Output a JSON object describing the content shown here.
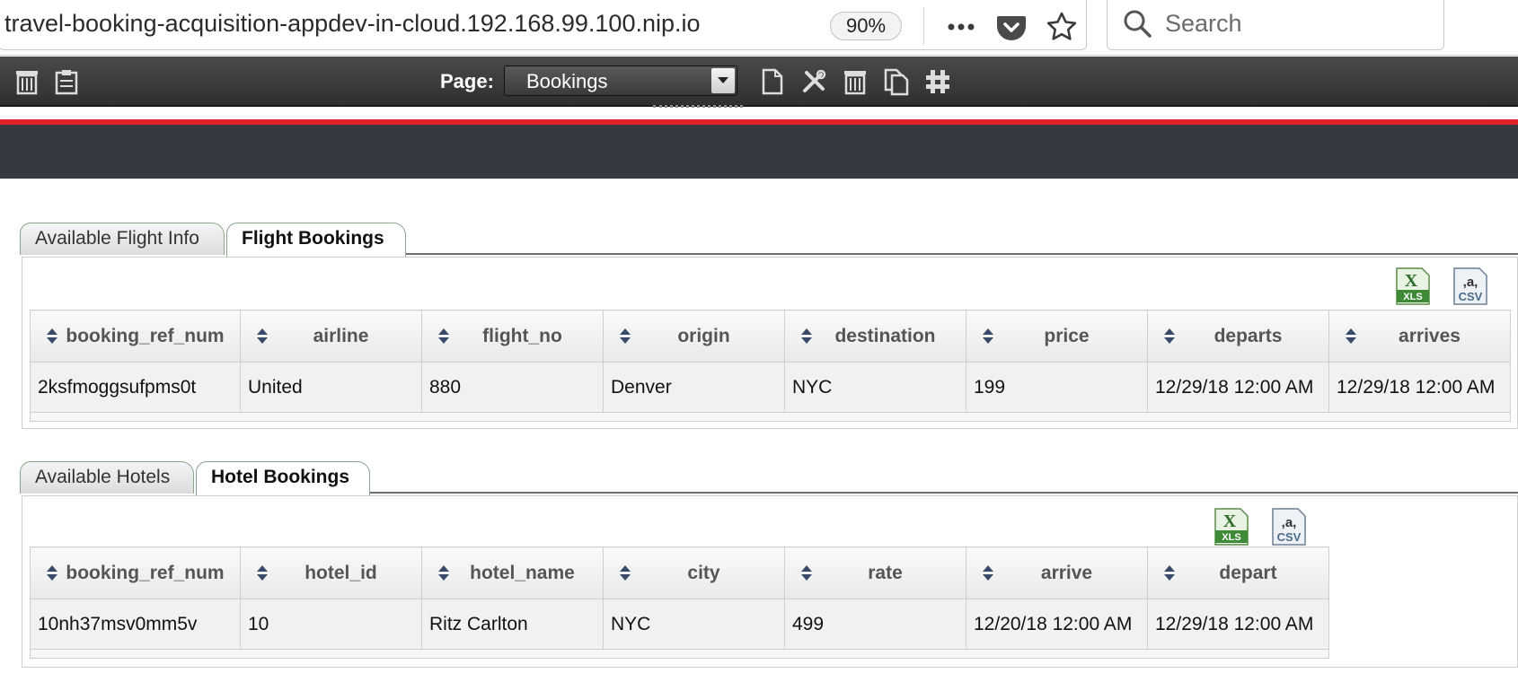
{
  "browser": {
    "url": "travel-booking-acquisition-appdev-in-cloud.192.168.99.100.nip.io",
    "zoom": "90%",
    "search_placeholder": "Search",
    "icons": [
      "more-icon",
      "pocket-icon",
      "bookmark-star-icon",
      "search-icon"
    ]
  },
  "toolbar": {
    "page_label": "Page:",
    "page_value": "Bookings",
    "icons": [
      "trash-icon",
      "clipboard-icon",
      "new-page-icon",
      "tools-icon",
      "delete-page-icon",
      "copy-page-icon",
      "layout-icon"
    ]
  },
  "theme": {
    "accent_red": "#e0202a",
    "dark_band": "#353a41",
    "toolbar_bg": "#3a3a3a"
  },
  "flights": {
    "tabs": [
      {
        "label": "Available Flight Info",
        "active": false
      },
      {
        "label": "Flight Bookings",
        "active": true
      }
    ],
    "export": [
      "xls-export-icon",
      "csv-export-icon"
    ],
    "columns": [
      "booking_ref_num",
      "airline",
      "flight_no",
      "origin",
      "destination",
      "price",
      "departs",
      "arrives"
    ],
    "rows": [
      [
        "2ksfmoggsufpms0t",
        "United",
        "880",
        "Denver",
        "NYC",
        "199",
        "12/29/18 12:00 AM",
        "12/29/18 12:00 AM"
      ]
    ]
  },
  "hotels": {
    "tabs": [
      {
        "label": "Available Hotels",
        "active": false
      },
      {
        "label": "Hotel Bookings",
        "active": true
      }
    ],
    "export": [
      "xls-export-icon",
      "csv-export-icon"
    ],
    "columns": [
      "booking_ref_num",
      "hotel_id",
      "hotel_name",
      "city",
      "rate",
      "arrive",
      "depart"
    ],
    "rows": [
      [
        "10nh37msv0mm5v",
        "10",
        "Ritz Carlton",
        "NYC",
        "499",
        "12/20/18 12:00 AM",
        "12/29/18 12:00 AM"
      ]
    ]
  }
}
